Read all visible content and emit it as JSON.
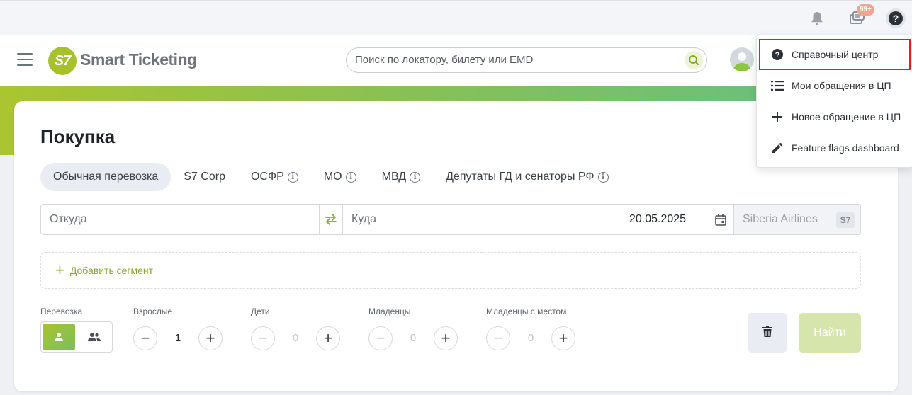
{
  "topbar": {
    "notifications_badge": "99+",
    "icons": [
      "bell-icon",
      "chat-icon",
      "help-icon"
    ]
  },
  "header": {
    "logo_mark": "S7",
    "logo_text": "Smart Ticketing",
    "search_placeholder": "Поиск по локатору, билету или EMD"
  },
  "colors": {
    "brand_green": "#a7c12b",
    "highlight_red": "#e02020"
  },
  "main": {
    "title": "Покупка",
    "tabs": [
      {
        "label": "Обычная перевозка",
        "active": true,
        "info": false
      },
      {
        "label": "S7 Corp",
        "active": false,
        "info": false
      },
      {
        "label": "ОСФР",
        "active": false,
        "info": true
      },
      {
        "label": "МО",
        "active": false,
        "info": true
      },
      {
        "label": "МВД",
        "active": false,
        "info": true
      },
      {
        "label": "Депутаты ГД и сенаторы РФ",
        "active": false,
        "info": true
      }
    ],
    "route": {
      "from_placeholder": "Откуда",
      "to_placeholder": "Куда",
      "date": "20.05.2025",
      "airline": "Siberia Airlines",
      "airline_code": "S7"
    },
    "add_segment": "Добавить сегмент",
    "passengers": {
      "transport_label": "Перевозка",
      "adults_label": "Взрослые",
      "adults": "1",
      "children_label": "Дети",
      "children": "0",
      "infants_label": "Младенцы",
      "infants": "0",
      "infants_seat_label": "Младенцы с местом",
      "infants_seat": "0"
    },
    "find_button": "Найти"
  },
  "dropdown": {
    "items": [
      {
        "label": "Справочный центр",
        "icon": "help-circle-icon",
        "highlighted": true
      },
      {
        "label": "Мои обращения в ЦП",
        "icon": "list-icon",
        "highlighted": false
      },
      {
        "label": "Новое обращение в ЦП",
        "icon": "plus-icon",
        "highlighted": false
      },
      {
        "label": "Feature flags dashboard",
        "icon": "pencil-icon",
        "highlighted": false
      }
    ]
  }
}
